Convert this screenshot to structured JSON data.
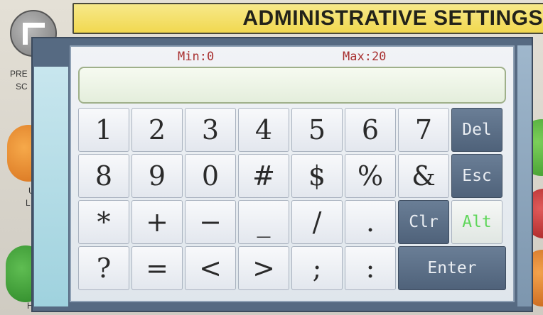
{
  "background": {
    "title": "ADMINISTRATIVE SETTINGS",
    "labels": {
      "pre": "PRE",
      "sc": "SC",
      "u": "U",
      "l": "L",
      "h": "H"
    }
  },
  "keypad": {
    "min_label": "Min:0",
    "max_label": "Max:20",
    "value": "",
    "rows": [
      [
        "1",
        "2",
        "3",
        "4",
        "5",
        "6",
        "7",
        "Del"
      ],
      [
        "8",
        "9",
        "0",
        "#",
        "$",
        "%",
        "&",
        "Esc"
      ],
      [
        "*",
        "+",
        "−",
        "_",
        "/",
        ".",
        "Clr",
        "Alt"
      ],
      [
        "?",
        "=",
        "<",
        ">",
        ";",
        ":",
        "Enter"
      ]
    ]
  },
  "colors": {
    "title_bar": "#f1d850",
    "dialog_frame": "#566a82",
    "range_text": "#a83030",
    "alt_text": "#5fd65a"
  }
}
